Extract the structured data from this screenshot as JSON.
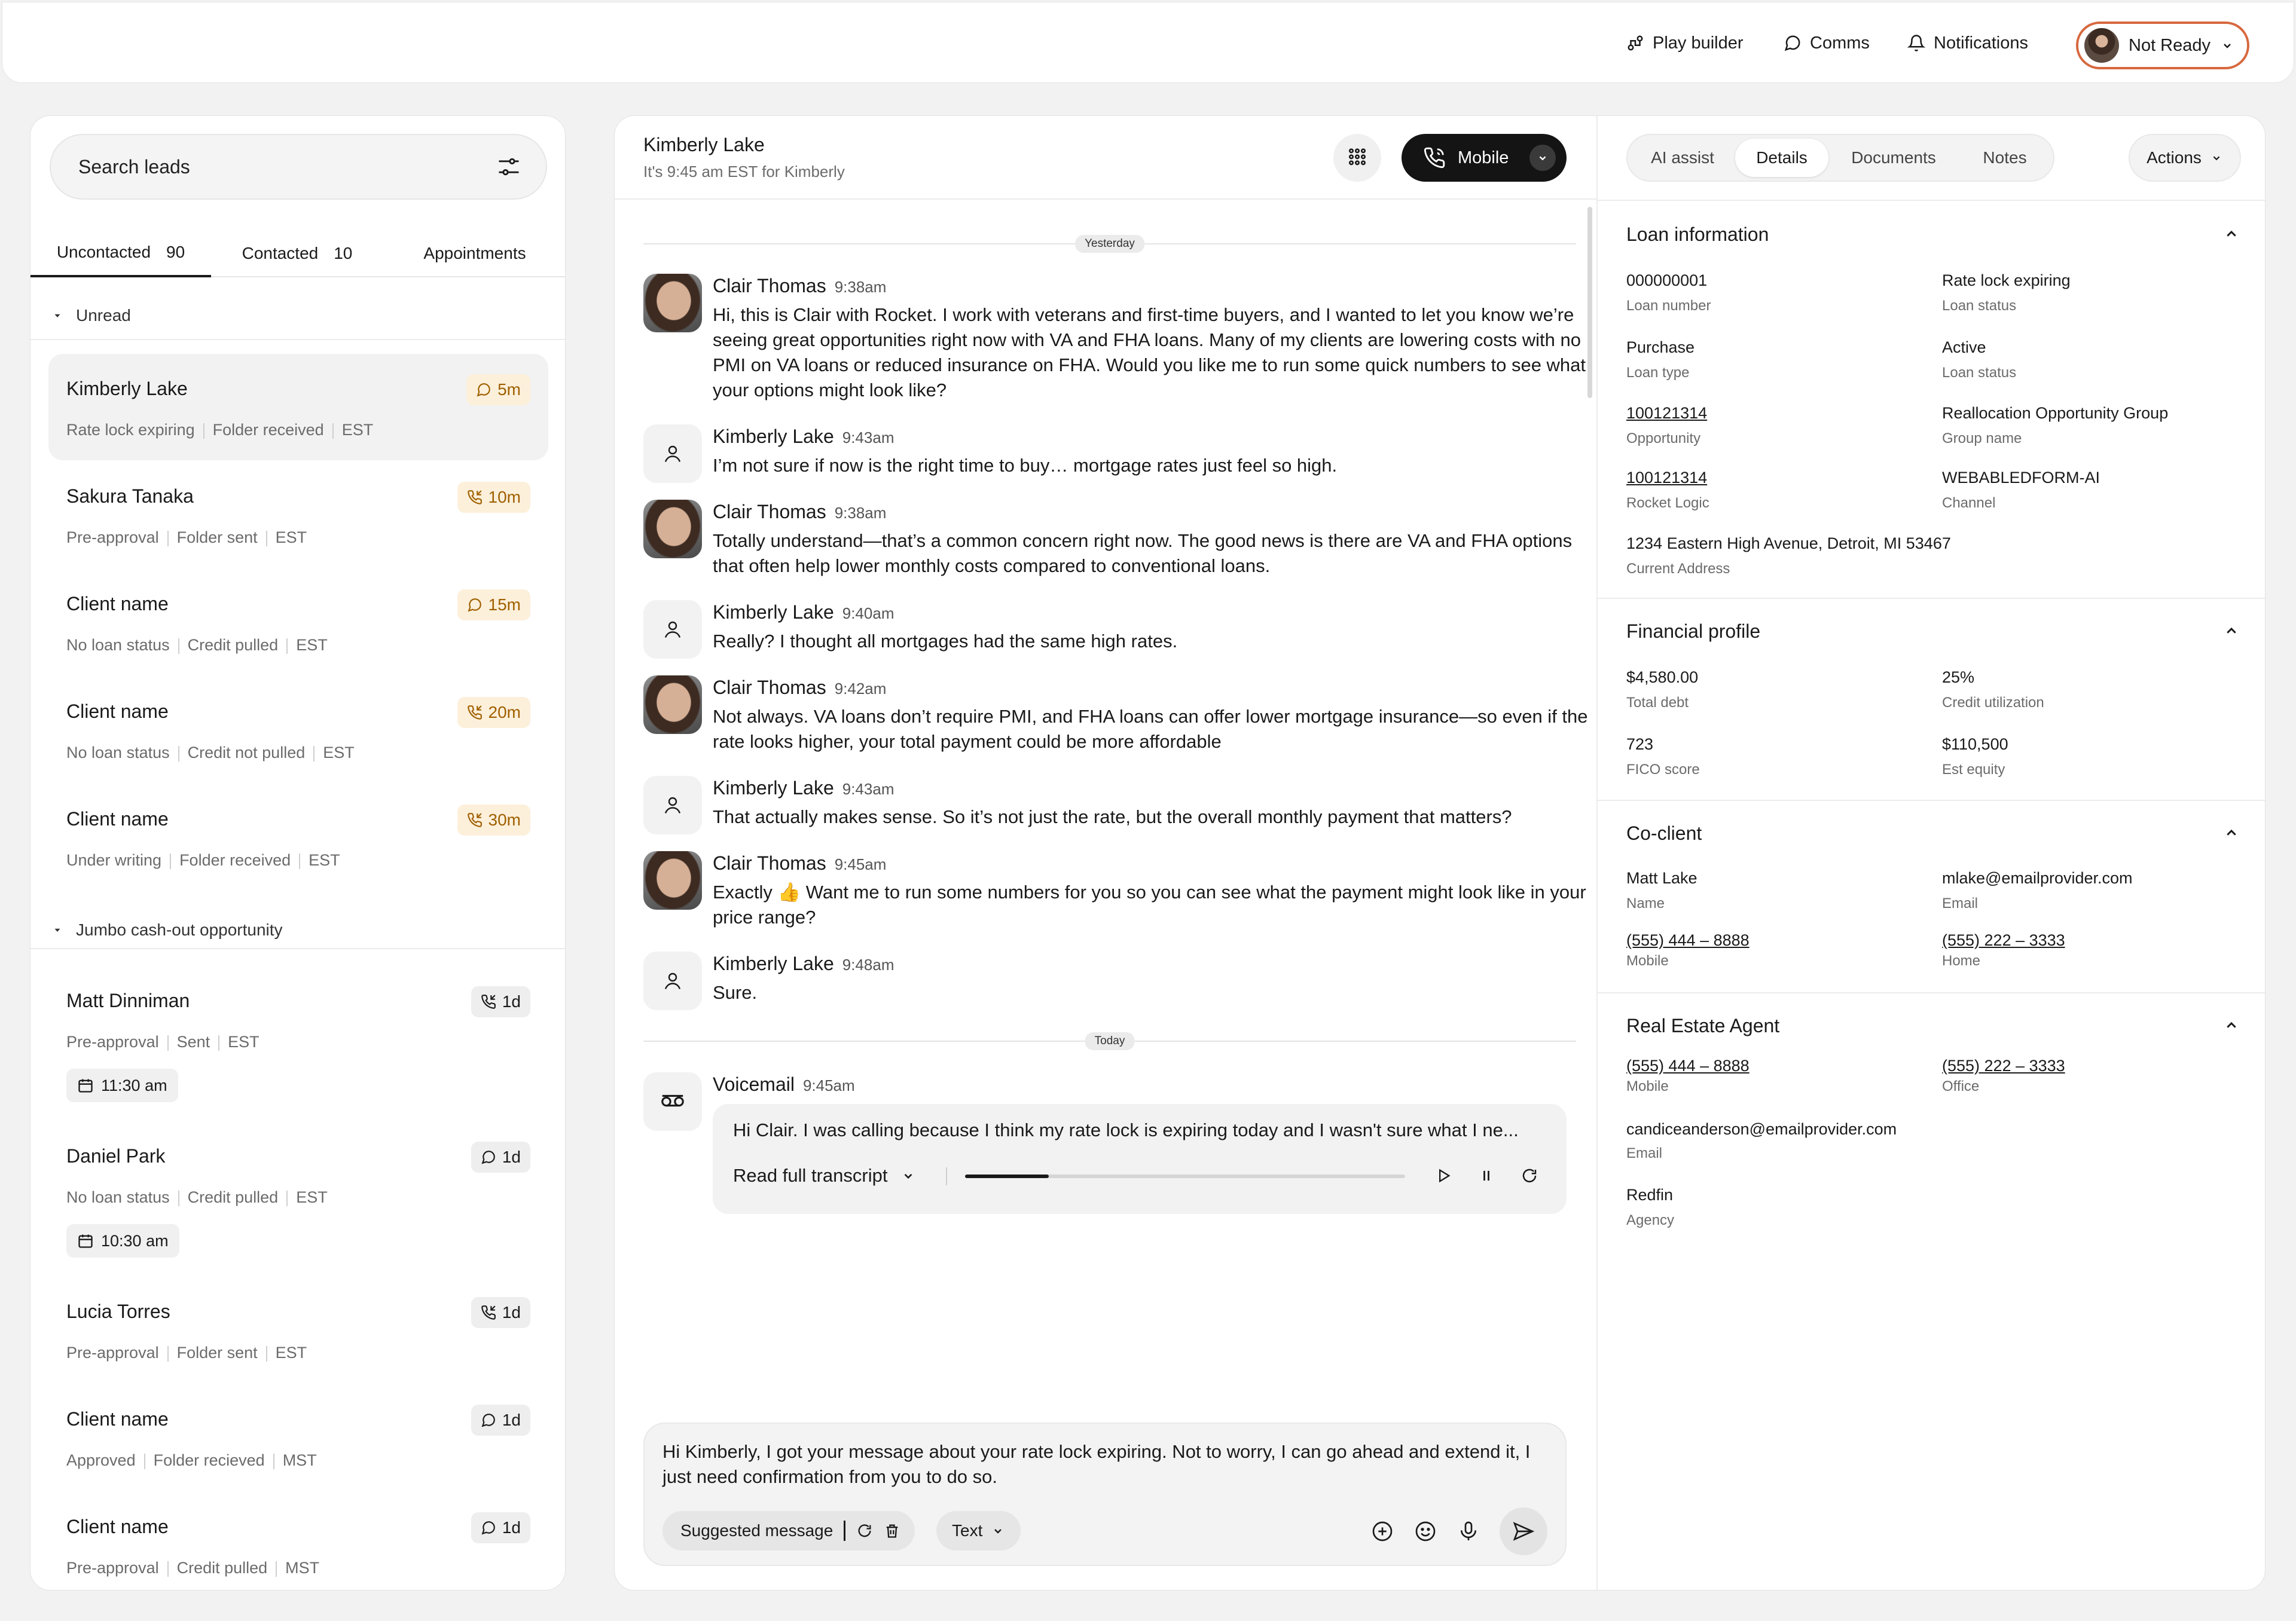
{
  "topbar": {
    "play_builder": "Play builder",
    "comms": "Comms",
    "notifications": "Notifications",
    "status": "Not Ready"
  },
  "leads": {
    "search_placeholder": "Search leads",
    "tabs": [
      {
        "label": "Uncontacted",
        "count": "90"
      },
      {
        "label": "Contacted",
        "count": "10"
      },
      {
        "label": "Appointments",
        "count": ""
      }
    ],
    "sections": [
      "Unread",
      "Jumbo cash-out opportunity"
    ],
    "items": [
      {
        "name": "Kimberly Lake",
        "meta": [
          "Rate lock expiring",
          "Folder received",
          "EST"
        ],
        "badge_icon": "message-icon",
        "badge": "5m",
        "appointment": ""
      },
      {
        "name": "Sakura Tanaka",
        "meta": [
          "Pre-approval",
          "Folder sent",
          "EST"
        ],
        "badge_icon": "phone-incoming-icon",
        "badge": "10m",
        "appointment": ""
      },
      {
        "name": "Client name",
        "meta": [
          "No loan status",
          "Credit pulled",
          "EST"
        ],
        "badge_icon": "message-icon",
        "badge": "15m",
        "appointment": ""
      },
      {
        "name": "Client name",
        "meta": [
          "No loan status",
          "Credit not pulled",
          "EST"
        ],
        "badge_icon": "phone-incoming-icon",
        "badge": "20m",
        "appointment": ""
      },
      {
        "name": "Client name",
        "meta": [
          "Under writing",
          "Folder received",
          "EST"
        ],
        "badge_icon": "phone-incoming-icon",
        "badge": "30m",
        "appointment": ""
      },
      {
        "name": "Matt Dinniman",
        "meta": [
          "Pre-approval",
          "Sent",
          "EST"
        ],
        "badge_icon": "phone-incoming-icon",
        "badge": "1d",
        "appointment": "11:30 am"
      },
      {
        "name": "Daniel Park",
        "meta": [
          "No loan status",
          "Credit pulled",
          "EST"
        ],
        "badge_icon": "message-icon",
        "badge": "1d",
        "appointment": "10:30 am"
      },
      {
        "name": "Lucia Torres",
        "meta": [
          "Pre-approval",
          "Folder sent",
          "EST"
        ],
        "badge_icon": "phone-incoming-icon",
        "badge": "1d",
        "appointment": ""
      },
      {
        "name": "Client name",
        "meta": [
          "Approved",
          "Folder recieved",
          "MST"
        ],
        "badge_icon": "message-icon",
        "badge": "1d",
        "appointment": ""
      },
      {
        "name": "Client name",
        "meta": [
          "Pre-approval",
          "Credit pulled",
          "MST"
        ],
        "badge_icon": "message-icon",
        "badge": "1d",
        "appointment": ""
      }
    ]
  },
  "chat": {
    "contact_name": "Kimberly Lake",
    "contact_sub": "It's 9:45 am EST for Kimberly",
    "call_label": "Mobile",
    "dividers": [
      "Yesterday",
      "Today"
    ],
    "messages": [
      {
        "sender": "Clair Thomas",
        "time": "9:38am",
        "avatar": "photo",
        "text": "Hi, this is Clair with Rocket. I work with veterans and first-time buyers, and I wanted to let you know we’re seeing great opportunities right now with VA and FHA loans. Many of my clients are lowering costs with no PMI on VA loans or reduced insurance on FHA. Would you like me to run some quick numbers to see what your options might look like?"
      },
      {
        "sender": "Kimberly Lake",
        "time": "9:43am",
        "avatar": "person",
        "text": "I’m not sure if now is the right time to buy… mortgage rates just feel so high."
      },
      {
        "sender": "Clair Thomas",
        "time": "9:38am",
        "avatar": "photo",
        "text": "Totally understand—that’s a common concern right now. The good news is there are VA and FHA options that often help lower monthly costs compared to conventional loans."
      },
      {
        "sender": "Kimberly Lake",
        "time": "9:40am",
        "avatar": "person",
        "text": "Really? I thought all mortgages had the same high rates."
      },
      {
        "sender": "Clair Thomas",
        "time": "9:42am",
        "avatar": "photo",
        "text": "Not always. VA loans don’t require PMI, and FHA loans can offer lower mortgage insurance—so even if the rate looks higher, your total payment could be more affordable"
      },
      {
        "sender": "Kimberly Lake",
        "time": "9:43am",
        "avatar": "person",
        "text": "That actually makes sense. So it’s not just the rate, but the overall monthly payment that matters?"
      },
      {
        "sender": "Clair Thomas",
        "time": "9:45am",
        "avatar": "photo",
        "text": "Exactly 👍 Want me to run some numbers for you so you can see what the payment might look like in your price range?"
      },
      {
        "sender": "Kimberly Lake",
        "time": "9:48am",
        "avatar": "person",
        "text": "Sure."
      }
    ],
    "voicemail": {
      "sender": "Voicemail",
      "time": "9:45am",
      "text": "Hi Clair. I was calling because I think my rate lock is expiring today and I wasn't sure what I ne...",
      "transcript_label": "Read full transcript",
      "progress": 0.19
    },
    "composer": {
      "text": "Hi Kimberly,  I got your message about your rate lock expiring. Not to worry, I can go ahead and extend it, I just need confirmation from you to do so.",
      "suggested_label": "Suggested message",
      "mode_label": "Text"
    }
  },
  "details": {
    "tabs": [
      "AI assist",
      "Details",
      "Documents",
      "Notes"
    ],
    "active_tab": "Details",
    "actions_label": "Actions",
    "loan": {
      "title": "Loan information",
      "fields": [
        {
          "value": "000000001",
          "label": "Loan number",
          "link": false
        },
        {
          "value": "Rate lock expiring",
          "label": "Loan status",
          "link": false
        },
        {
          "value": "Purchase",
          "label": "Loan type",
          "link": false
        },
        {
          "value": "Active",
          "label": "Loan status",
          "link": false
        },
        {
          "value": "100121314",
          "label": "Opportunity",
          "link": true
        },
        {
          "value": "Reallocation Opportunity Group",
          "label": "Group name",
          "link": false
        },
        {
          "value": "100121314",
          "label": "Rocket Logic",
          "link": true
        },
        {
          "value": "WEBABLEDFORM-AI",
          "label": "Channel",
          "link": false
        }
      ],
      "address": {
        "value": "1234 Eastern High Avenue, Detroit, MI 53467",
        "label": "Current Address"
      }
    },
    "financial": {
      "title": "Financial profile",
      "fields": [
        {
          "value": "$4,580.00",
          "label": "Total debt"
        },
        {
          "value": "25%",
          "label": "Credit utilization"
        },
        {
          "value": "723",
          "label": "FICO score"
        },
        {
          "value": "$110,500",
          "label": "Est equity"
        }
      ]
    },
    "coclient": {
      "title": "Co-client",
      "fields": [
        {
          "value": "Matt Lake",
          "label": "Name",
          "link": false
        },
        {
          "value": "mlake@emailprovider.com",
          "label": "Email",
          "link": false
        },
        {
          "value": "(555) 444 – 8888",
          "label": "Mobile",
          "link": true
        },
        {
          "value": "(555) 222 – 3333",
          "label": "Home",
          "link": true
        }
      ]
    },
    "agent": {
      "title": "Real Estate Agent",
      "fields": [
        {
          "value": "(555) 444 – 8888",
          "label": "Mobile",
          "link": true
        },
        {
          "value": "(555) 222 – 3333",
          "label": "Office",
          "link": true
        },
        {
          "value": "candiceanderson@emailprovider.com",
          "label": "Email",
          "link": false
        },
        {
          "value": "Redfin",
          "label": "Agency",
          "link": false
        }
      ]
    }
  },
  "colors": {
    "status_border": "#d7683e",
    "badge_warm_bg": "#fcf0db",
    "badge_warm_fg": "#a06000",
    "call_button": "#141414"
  }
}
